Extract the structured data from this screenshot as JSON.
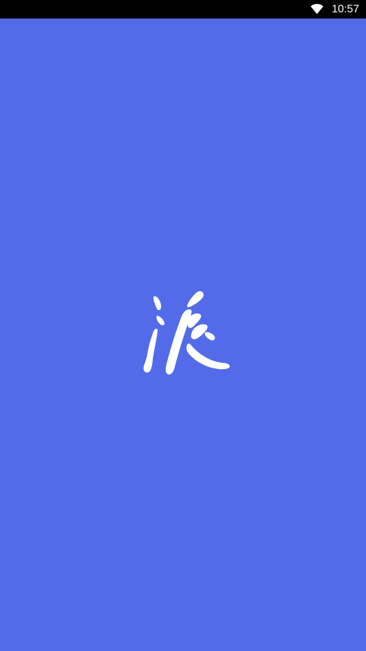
{
  "status_bar": {
    "time": "10:57",
    "wifi_icon": "wifi-icon",
    "background": "#000000"
  },
  "splash": {
    "background": "#536BE8",
    "logo": {
      "character": "派",
      "icon": "pai-calligraphy-logo",
      "color": "#FFFFFF"
    }
  }
}
